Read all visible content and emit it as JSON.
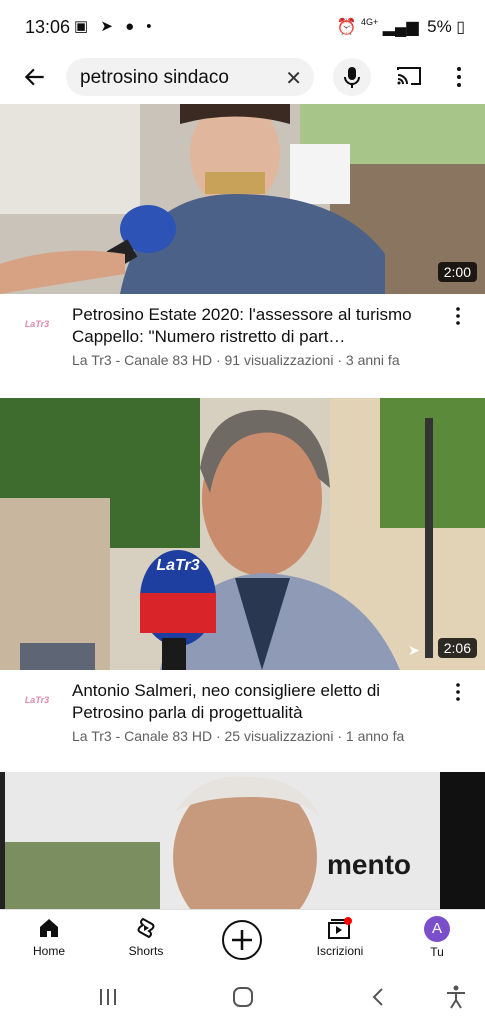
{
  "status_bar": {
    "time": "13:06",
    "battery": "5%",
    "network": "4G+"
  },
  "search": {
    "query": "petrosino sindaco"
  },
  "videos": [
    {
      "title": "Petrosino Estate 2020: l'assessore al turismo Cappello: \"Numero ristretto di part…",
      "channel": "La Tr3 - Canale 83 HD",
      "views": "91 visualizzazioni",
      "age": "3 anni fa",
      "meta": "La Tr3 - Canale 83 HD · 91 visualizzazioni · 3 anni fa",
      "duration": "2:00",
      "avatar_text": "LaTr3"
    },
    {
      "title": "Antonio Salmeri, neo consigliere eletto di Petrosino parla di progettualità",
      "channel": "La Tr3 - Canale 83 HD",
      "views": "25 visualizzazioni",
      "age": "1 anno fa",
      "meta": "La Tr3 - Canale 83 HD · 25 visualizzazioni · 1 anno fa",
      "duration": "2:06",
      "avatar_text": "LaTr3",
      "mic_logo": "LaTr3"
    }
  ],
  "third_thumb_text": "mento",
  "nav": {
    "home": "Home",
    "shorts": "Shorts",
    "subscriptions": "Iscrizioni",
    "you": "Tu",
    "you_avatar": "A"
  },
  "colors": {
    "accent_red": "#ff0000",
    "avatar_purple": "#7b4fc9",
    "meta_gray": "#606060"
  }
}
